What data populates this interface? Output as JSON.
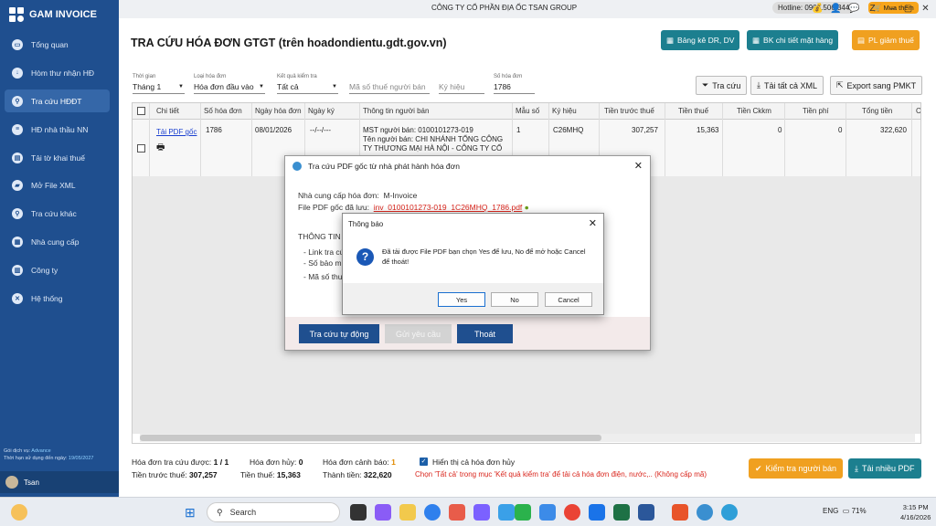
{
  "app": {
    "name": "GAM INVOICE"
  },
  "sidebar": {
    "items": [
      {
        "label": "Tổng quan",
        "icon": "monitor-icon"
      },
      {
        "label": "Hòm thư nhận HĐ",
        "icon": "inbox-icon"
      },
      {
        "label": "Tra cứu HĐĐT",
        "icon": "search-doc-icon"
      },
      {
        "label": "HĐ nhà thầu NN",
        "icon": "contract-icon"
      },
      {
        "label": "Tải tờ khai thuế",
        "icon": "download-icon"
      },
      {
        "label": "Mở File XML",
        "icon": "folder-icon"
      },
      {
        "label": "Tra cứu khác",
        "icon": "search-icon"
      },
      {
        "label": "Nhà cung cấp",
        "icon": "supplier-icon"
      },
      {
        "label": "Công ty",
        "icon": "company-icon"
      },
      {
        "label": "Hệ thống",
        "icon": "settings-icon"
      }
    ],
    "service_label": "Gói dịch vụ:",
    "service_value": "Advance",
    "expiry_label": "Thời hạn sử dụng đến ngày:",
    "expiry_value": "19/05/2027",
    "user": "Tsan"
  },
  "topbar": {
    "company": "CÔNG TY CỔ PHẦN ĐỊA ỐC TSAN GROUP",
    "hotline": "Hotline: 0904.506.344",
    "buy": "Mua thêm"
  },
  "header": {
    "title": "TRA CỨU HÓA ĐƠN GTGT (trên hoadondientu.gdt.gov.vn)",
    "btn_bangke": "Bảng kê DR, DV",
    "btn_bkchitiet": "BK chi tiết mặt hàng",
    "btn_plgiam": "PL giảm thuế"
  },
  "filters": {
    "period_label": "Thời gian",
    "period_value": "Tháng 1",
    "type_label": "Loại hóa đơn",
    "type_value": "Hóa đơn đầu vào",
    "result_label": "Kết quả kiểm tra",
    "result_value": "Tất cả",
    "tax_placeholder": "Mã số thuế người bán",
    "symbol_placeholder": "Ký hiệu",
    "number_label": "Số hóa đơn",
    "number_value": "1786",
    "btn_search": "Tra cứu",
    "btn_xml": "Tải tất cả XML",
    "btn_export": "Export sang PMKT"
  },
  "table": {
    "headers": [
      "Chi tiết",
      "Số hóa đơn",
      "Ngày hóa đơn",
      "Ngày ký",
      "Thông tin người bán",
      "Mẫu số",
      "Ký hiệu",
      "Tiền trước thuế",
      "Tiền thuế",
      "Tiền Ckkm",
      "Tiền phí",
      "Tổng tiền",
      "C"
    ],
    "row": {
      "detail_link": "Tải PDF gốc",
      "number": "1786",
      "date": "08/01/2026",
      "signed": "--/--/---",
      "seller_line1": "MST người bán: 0100101273-019",
      "seller_line2": "Tên người bán: CHI NHÁNH TỔNG CÔNG",
      "seller_line3": "TY THƯƠNG MẠI HÀ NỘI - CÔNG TY CỔ",
      "form": "1",
      "symbol": "C26MHQ",
      "pretax": "307,257",
      "tax": "15,363",
      "ckkm": "0",
      "fee": "0",
      "total": "322,620"
    }
  },
  "footer": {
    "count_label": "Hóa đơn tra cứu được:",
    "count_value": "1 / 1",
    "cancel_label": "Hóa đơn hủy:",
    "cancel_value": "0",
    "warn_label": "Hóa đơn cảnh báo:",
    "warn_value": "1",
    "show_cancel": "Hiển thị cả hóa đơn hủy",
    "pretax_label": "Tiền trước thuế:",
    "pretax_value": "307,257",
    "tax_label": "Tiền thuế:",
    "tax_value": "15,363",
    "total_label": "Thành tiền:",
    "total_value": "322,620",
    "note": "Chọn 'Tất cả' trong mục 'Kết quả kiểm tra' để tải cả hóa đơn điện, nước,.. (Không cấp mã)",
    "btn_check": "Kiểm tra người bán",
    "btn_pdf": "Tải nhiều PDF"
  },
  "dialog_pdf": {
    "title": "Tra cứu PDF gốc từ nhà phát hành hóa đơn",
    "provider_label": "Nhà cung cấp hóa đơn:",
    "provider_value": "M-Invoice",
    "file_label": "File PDF gốc đã lưu:",
    "file_value": "inv_0100101273-019_1C26MHQ_1786.pdf",
    "info_title": "THÔNG TIN T",
    "line1": "- Link tra cứ",
    "line2": "- Số bảo m",
    "line3": "- Mã số thu",
    "btn_auto": "Tra cứu tự động",
    "btn_send": "Gửi yêu cầu",
    "btn_exit": "Thoát"
  },
  "dialog_msg": {
    "title": "Thông báo",
    "message": "Đã tải được File PDF bạn chọn Yes để lưu, No để mở hoặc Cancel để thoát!",
    "yes": "Yes",
    "no": "No",
    "cancel": "Cancel"
  },
  "taskbar": {
    "search": "Search",
    "lang": "ENG",
    "battery": "71%",
    "time": "3:15 PM",
    "date": "4/16/2026"
  }
}
